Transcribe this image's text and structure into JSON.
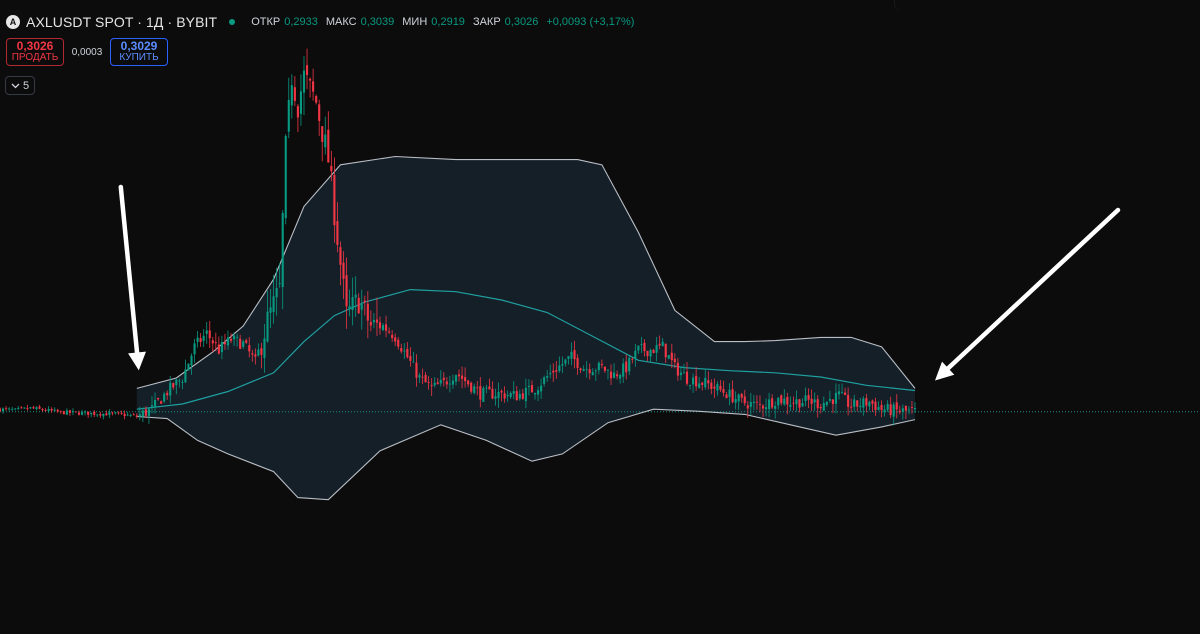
{
  "header": {
    "logo_text": "A",
    "title": "AXLUSDT SPOT · 1Д · BYBIT",
    "ohlc": {
      "open_label": "ОТКР",
      "open": "0,2933",
      "high_label": "МАКС",
      "high": "0,3039",
      "low_label": "МИН",
      "low": "0,2919",
      "close_label": "ЗАКР",
      "close": "0,3026",
      "change": "+0,0093 (+3,17%)"
    }
  },
  "trade": {
    "sell_price": "0,3026",
    "sell_label": "ПРОДАТЬ",
    "spread": "0,0003",
    "buy_price": "0,3029",
    "buy_label": "КУПИТЬ"
  },
  "indicators_toggle": {
    "icon": "chevron-down-icon",
    "count": "5"
  },
  "colors": {
    "background": "#0c0c0c",
    "up": "#089981",
    "down": "#f23645",
    "band_fill": "#16212a",
    "band_line": "#b9bec6",
    "basis": "#1f9fa0",
    "price_line": "#1e8f85",
    "annotation_arrow": "#ffffff"
  },
  "chart_data": {
    "type": "candlestick",
    "symbol": "AXLUSDT",
    "interval": "1D",
    "exchange": "BYBIT",
    "grid": false,
    "indicator": "bollinger-style envelope (upper, basis, lower)",
    "price_range": [
      0.16,
      0.66
    ],
    "last_close": 0.3026,
    "bars": 302,
    "close_path": [
      [
        0,
        0.305
      ],
      [
        5,
        0.304
      ],
      [
        10,
        0.306
      ],
      [
        20,
        0.302
      ],
      [
        30,
        0.301
      ],
      [
        40,
        0.3
      ],
      [
        45,
        0.298
      ],
      [
        50,
        0.305
      ],
      [
        55,
        0.322
      ],
      [
        60,
        0.335
      ],
      [
        64,
        0.365
      ],
      [
        68,
        0.378
      ],
      [
        72,
        0.362
      ],
      [
        76,
        0.372
      ],
      [
        80,
        0.368
      ],
      [
        84,
        0.35
      ],
      [
        88,
        0.39
      ],
      [
        92,
        0.42
      ],
      [
        94,
        0.555
      ],
      [
        96,
        0.625
      ],
      [
        98,
        0.598
      ],
      [
        100,
        0.625
      ],
      [
        104,
        0.6
      ],
      [
        108,
        0.545
      ],
      [
        111,
        0.47
      ],
      [
        114,
        0.395
      ],
      [
        118,
        0.41
      ],
      [
        122,
        0.385
      ],
      [
        126,
        0.385
      ],
      [
        130,
        0.375
      ],
      [
        134,
        0.355
      ],
      [
        138,
        0.335
      ],
      [
        142,
        0.325
      ],
      [
        146,
        0.33
      ],
      [
        150,
        0.34
      ],
      [
        154,
        0.33
      ],
      [
        158,
        0.32
      ],
      [
        164,
        0.32
      ],
      [
        170,
        0.318
      ],
      [
        176,
        0.325
      ],
      [
        182,
        0.342
      ],
      [
        188,
        0.355
      ],
      [
        192,
        0.345
      ],
      [
        198,
        0.345
      ],
      [
        202,
        0.338
      ],
      [
        206,
        0.345
      ],
      [
        210,
        0.362
      ],
      [
        214,
        0.362
      ],
      [
        218,
        0.365
      ],
      [
        222,
        0.345
      ],
      [
        226,
        0.335
      ],
      [
        232,
        0.33
      ],
      [
        238,
        0.322
      ],
      [
        244,
        0.312
      ],
      [
        250,
        0.308
      ],
      [
        256,
        0.315
      ],
      [
        260,
        0.312
      ],
      [
        266,
        0.313
      ],
      [
        270,
        0.31
      ],
      [
        276,
        0.318
      ],
      [
        280,
        0.308
      ],
      [
        286,
        0.312
      ],
      [
        290,
        0.305
      ],
      [
        296,
        0.303
      ],
      [
        301,
        0.3026
      ]
    ],
    "upper_band": [
      [
        45,
        0.325
      ],
      [
        58,
        0.335
      ],
      [
        70,
        0.36
      ],
      [
        80,
        0.385
      ],
      [
        90,
        0.43
      ],
      [
        100,
        0.5
      ],
      [
        112,
        0.54
      ],
      [
        130,
        0.548
      ],
      [
        150,
        0.545
      ],
      [
        175,
        0.545
      ],
      [
        190,
        0.545
      ],
      [
        198,
        0.54
      ],
      [
        210,
        0.475
      ],
      [
        222,
        0.4
      ],
      [
        235,
        0.37
      ],
      [
        245,
        0.37
      ],
      [
        255,
        0.371
      ],
      [
        270,
        0.374
      ],
      [
        280,
        0.374
      ],
      [
        290,
        0.365
      ],
      [
        301,
        0.325
      ]
    ],
    "basis": [
      [
        45,
        0.305
      ],
      [
        60,
        0.31
      ],
      [
        75,
        0.322
      ],
      [
        90,
        0.34
      ],
      [
        100,
        0.37
      ],
      [
        110,
        0.395
      ],
      [
        120,
        0.408
      ],
      [
        135,
        0.42
      ],
      [
        150,
        0.418
      ],
      [
        165,
        0.41
      ],
      [
        180,
        0.398
      ],
      [
        195,
        0.375
      ],
      [
        210,
        0.352
      ],
      [
        225,
        0.345
      ],
      [
        240,
        0.342
      ],
      [
        255,
        0.34
      ],
      [
        270,
        0.336
      ],
      [
        285,
        0.328
      ],
      [
        301,
        0.323
      ]
    ],
    "lower_band": [
      [
        45,
        0.298
      ],
      [
        55,
        0.296
      ],
      [
        65,
        0.275
      ],
      [
        75,
        0.262
      ],
      [
        90,
        0.245
      ],
      [
        98,
        0.22
      ],
      [
        108,
        0.218
      ],
      [
        125,
        0.265
      ],
      [
        145,
        0.29
      ],
      [
        160,
        0.275
      ],
      [
        175,
        0.255
      ],
      [
        185,
        0.262
      ],
      [
        200,
        0.292
      ],
      [
        215,
        0.305
      ],
      [
        230,
        0.303
      ],
      [
        245,
        0.3
      ],
      [
        260,
        0.29
      ],
      [
        275,
        0.28
      ],
      [
        290,
        0.288
      ],
      [
        301,
        0.295
      ]
    ],
    "annotations": [
      {
        "type": "arrow",
        "points_to": "band start",
        "bar_index": 45,
        "price": 0.325
      },
      {
        "type": "arrow",
        "points_to": "band end",
        "bar_index": 301,
        "price": 0.323
      }
    ]
  }
}
